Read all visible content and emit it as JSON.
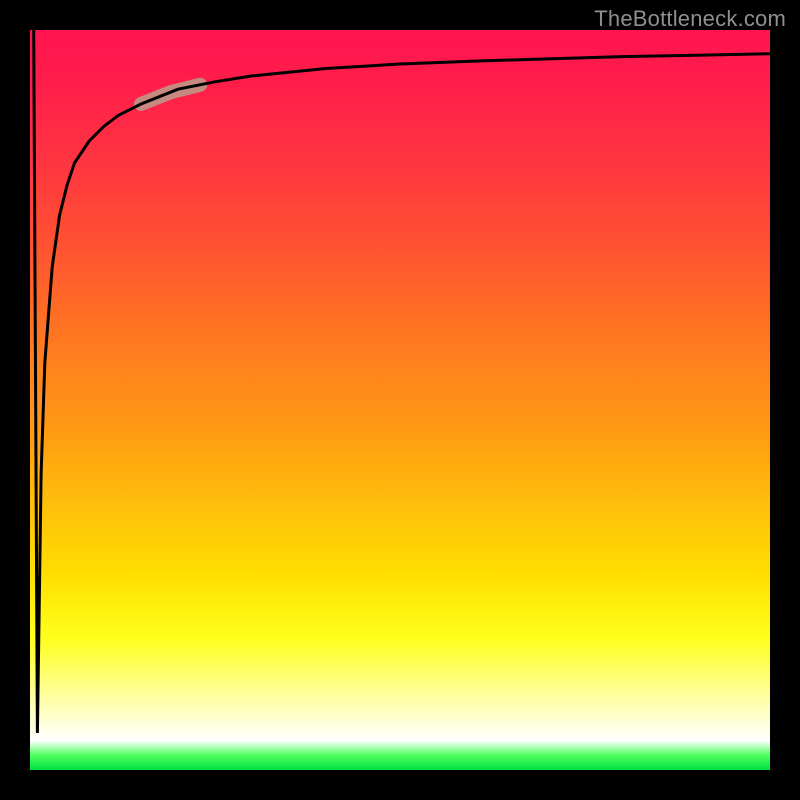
{
  "attribution": "TheBottleneck.com",
  "chart_data": {
    "type": "line",
    "title": "",
    "xlabel": "",
    "ylabel": "",
    "xlim": [
      0,
      100
    ],
    "ylim": [
      0,
      100
    ],
    "grid": false,
    "legend": false,
    "background_gradient_stops": [
      {
        "pos": 0,
        "color": "#ff1450"
      },
      {
        "pos": 50,
        "color": "#ff9a14"
      },
      {
        "pos": 85,
        "color": "#ffff1a"
      },
      {
        "pos": 96,
        "color": "#ffffff"
      },
      {
        "pos": 100,
        "color": "#00e040"
      }
    ],
    "series": [
      {
        "name": "curve",
        "x": [
          0.5,
          1,
          1.5,
          2,
          3,
          4,
          5,
          6,
          8,
          10,
          12,
          15,
          20,
          25,
          30,
          40,
          50,
          60,
          70,
          80,
          90,
          100
        ],
        "y": [
          100,
          5,
          40,
          55,
          68,
          75,
          79,
          82,
          85,
          87,
          88.5,
          90,
          92,
          93,
          93.8,
          94.8,
          95.4,
          95.8,
          96.1,
          96.4,
          96.6,
          96.8
        ],
        "stroke": "#000000",
        "stroke_width": 3
      }
    ],
    "highlight": {
      "x_range": [
        15,
        23
      ],
      "y_range": [
        85,
        88
      ],
      "color": "#c58a80",
      "width": 14
    }
  }
}
